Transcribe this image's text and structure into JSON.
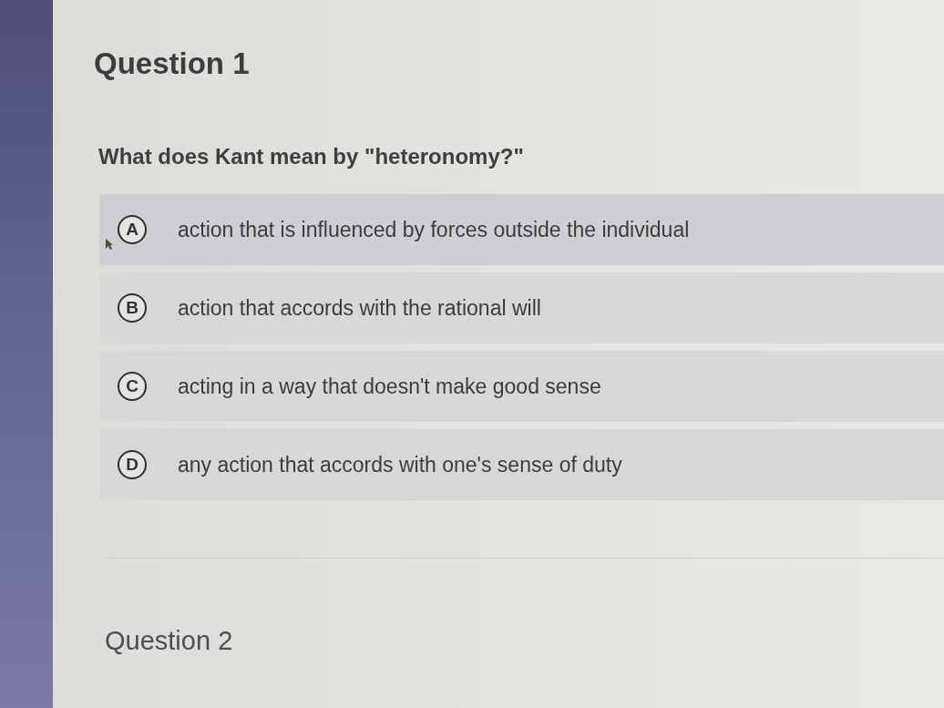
{
  "questions": [
    {
      "title": "Question 1",
      "prompt": "What does Kant mean by \"heteronomy?\"",
      "options": [
        {
          "letter": "A",
          "text": "action that is influenced by forces outside the individual",
          "hovered": true
        },
        {
          "letter": "B",
          "text": "action that accords with the rational will",
          "hovered": false
        },
        {
          "letter": "C",
          "text": "acting in a way that doesn't make good sense",
          "hovered": false
        },
        {
          "letter": "D",
          "text": "any action that accords with one's sense of duty",
          "hovered": false
        }
      ]
    },
    {
      "title": "Question 2"
    }
  ]
}
